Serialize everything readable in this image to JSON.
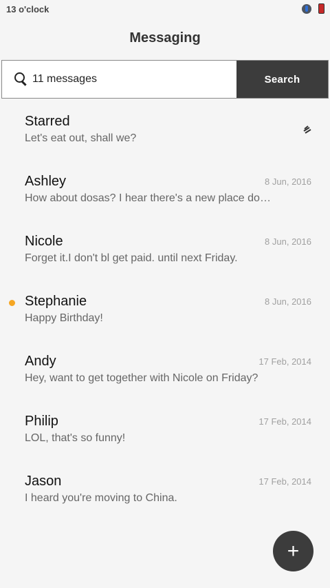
{
  "status_bar": {
    "time": "13 o'clock",
    "icons": [
      "mic-icon",
      "battery-icon"
    ]
  },
  "header": {
    "title": "Messaging"
  },
  "search": {
    "value": "11 messages",
    "button_label": "Search"
  },
  "conversations": [
    {
      "name": "Starred",
      "preview": "Let's eat out, shall we?",
      "date": "",
      "icon": "starred-icon"
    },
    {
      "name": "Ashley",
      "preview": "How about dosas? I hear there's a new place do…",
      "date": "8 Jun, 2016"
    },
    {
      "name": "Nicole",
      "preview": "Forget it.I don't bl get paid. until next Friday.",
      "date": "8 Jun, 2016"
    },
    {
      "name": "Stephanie",
      "preview": "Happy Birthday!",
      "date": "8 Jun, 2016",
      "unread": true
    },
    {
      "name": "Andy",
      "preview": "Hey, want to get together with Nicole on Friday?",
      "date": "17 Feb, 2014"
    },
    {
      "name": "Philip",
      "preview": "LOL, that's so funny!",
      "date": "17 Feb, 2014"
    },
    {
      "name": "Jason",
      "preview": "I heard you're moving to China.",
      "date": "17 Feb, 2014"
    }
  ],
  "fab": {
    "label": "+"
  },
  "colors": {
    "accent_dark": "#3c3c3c",
    "unread": "#f5a623",
    "background": "#f5f5f5"
  }
}
